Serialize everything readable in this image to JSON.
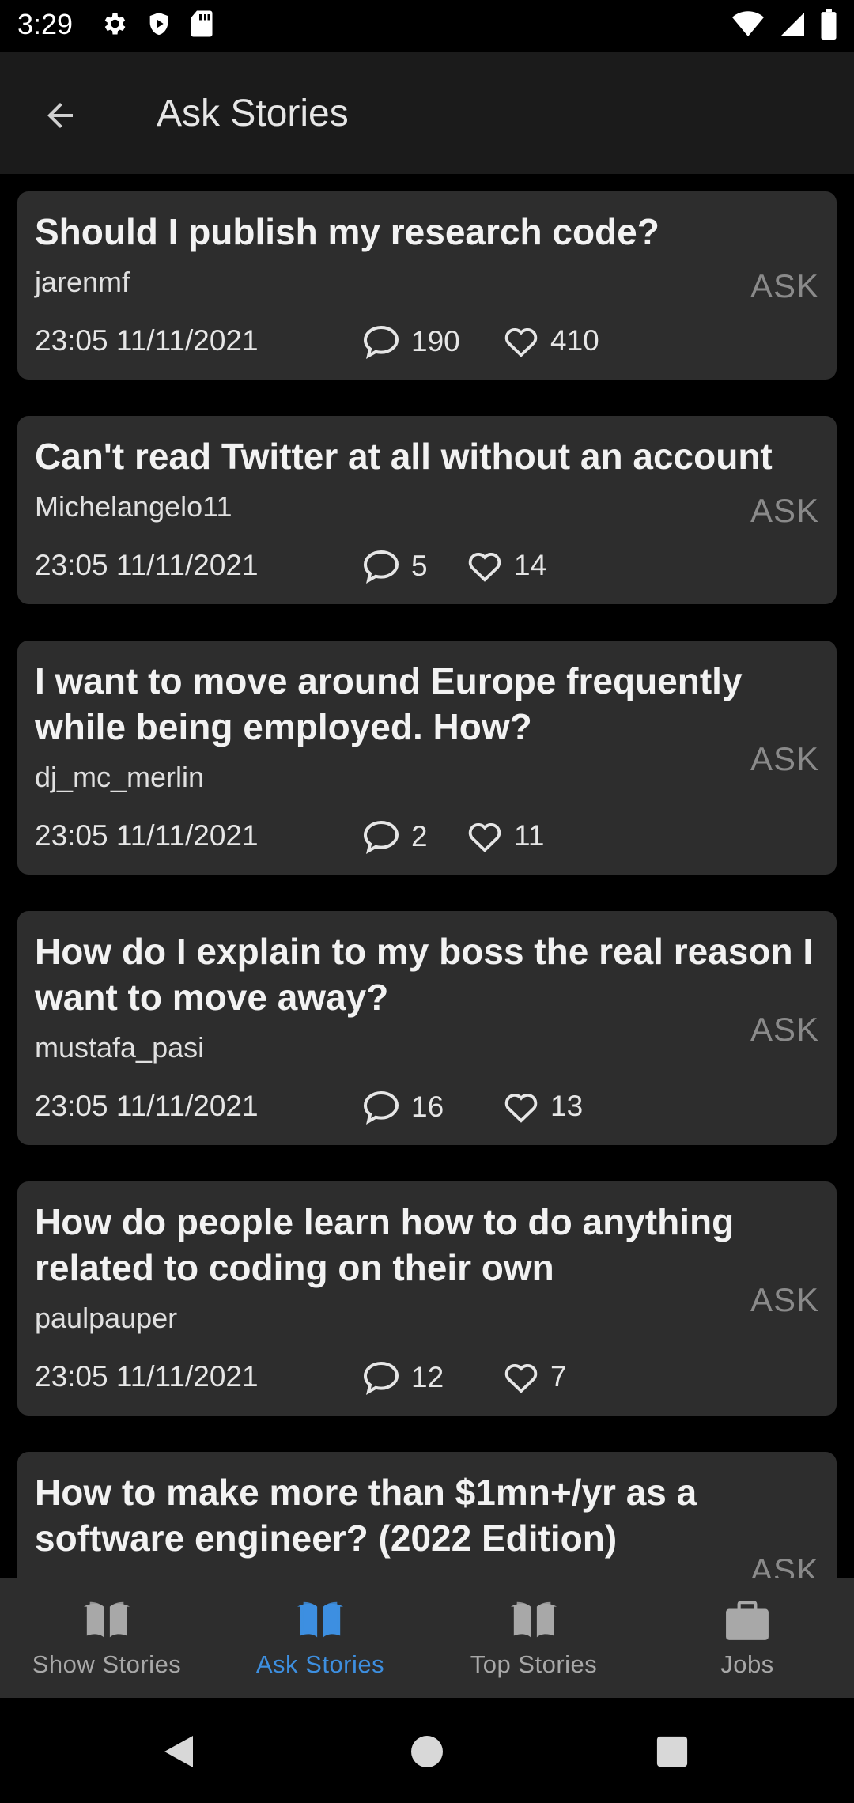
{
  "status_bar": {
    "time": "3:29"
  },
  "app_bar": {
    "title": "Ask Stories"
  },
  "stories": [
    {
      "title": "Should I publish my research code?",
      "author": "jarenmf",
      "date": "23:05 11/11/2021",
      "comments": "190",
      "likes": "410",
      "tag": "ASK"
    },
    {
      "title": "Can't read Twitter at all without an account",
      "author": "Michelangelo11",
      "date": "23:05 11/11/2021",
      "comments": "5",
      "likes": "14",
      "tag": "ASK"
    },
    {
      "title": "I want to move around Europe frequently while being employed. How?",
      "author": "dj_mc_merlin",
      "date": "23:05 11/11/2021",
      "comments": "2",
      "likes": "11",
      "tag": "ASK"
    },
    {
      "title": "How do I explain to my boss the real reason I want to move away?",
      "author": "mustafa_pasi",
      "date": "23:05 11/11/2021",
      "comments": "16",
      "likes": "13",
      "tag": "ASK"
    },
    {
      "title": "How do people learn how to do anything related to coding on their own",
      "author": "paulpauper",
      "date": "23:05 11/11/2021",
      "comments": "12",
      "likes": "7",
      "tag": "ASK"
    },
    {
      "title": "How to make more than $1mn+/yr as a software engineer? (2022 Edition)",
      "tag": "ASK"
    }
  ],
  "bottom_nav": [
    {
      "label": "Show Stories",
      "icon": "book-icon"
    },
    {
      "label": "Ask Stories",
      "icon": "book-icon"
    },
    {
      "label": "Top Stories",
      "icon": "book-icon"
    },
    {
      "label": "Jobs",
      "icon": "briefcase-icon"
    }
  ],
  "colors": {
    "accent": "#3d8fe0",
    "card": "#2d2d2d",
    "background": "#000000",
    "app_bar": "#1b1b1b"
  }
}
